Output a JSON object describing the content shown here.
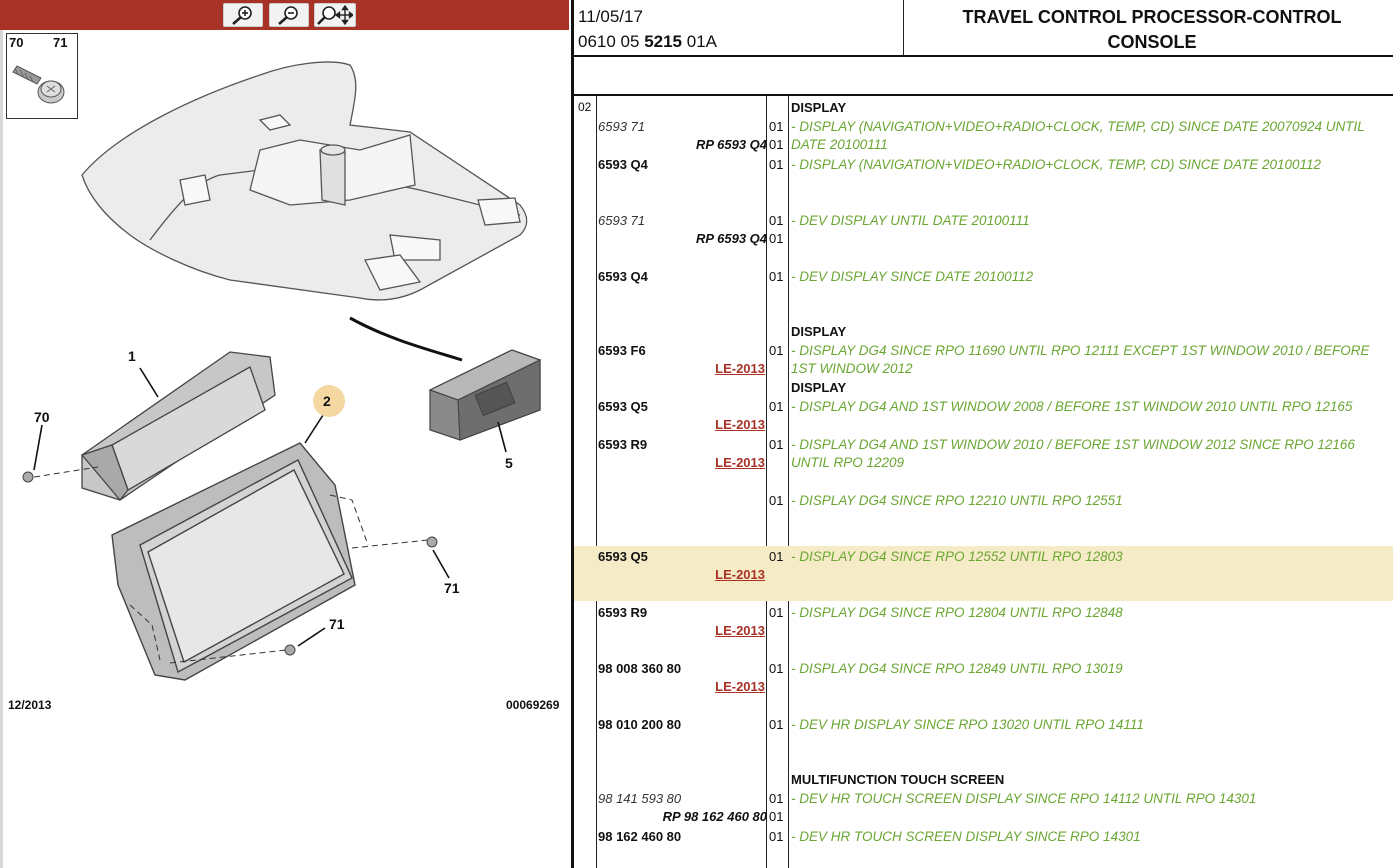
{
  "toolbar": {
    "zoom_in": "zoom-in-icon",
    "zoom_out": "zoom-out-icon",
    "zoom_pan": "zoom-pan-icon",
    "bar_color": "#a93226"
  },
  "diagram": {
    "screw_box_labels": [
      "70",
      "71"
    ],
    "callouts": [
      "1",
      "2",
      "70",
      "5",
      "71",
      "71"
    ],
    "date": "12/2013",
    "ref": "00069269"
  },
  "header": {
    "date": "11/05/17",
    "code_prefix": "0610 05 ",
    "code_bold": "5215",
    "code_suffix": " 01A",
    "title_line1": "TRAVEL CONTROL PROCESSOR-CONTROL",
    "title_line2": "CONSOLE"
  },
  "table": {
    "group": "02",
    "rows": [
      {
        "heading": "DISPLAY"
      },
      {
        "part": "6593 71",
        "replaced_by": "RP 6593 Q4",
        "qty": "01",
        "qty2": "01",
        "desc": "- DISPLAY (NAVIGATION+VIDEO+RADIO+CLOCK, TEMP, CD) SINCE DATE 20070924 UNTIL DATE 20100111"
      },
      {
        "part": "6593 Q4",
        "qty": "01",
        "desc": "- DISPLAY (NAVIGATION+VIDEO+RADIO+CLOCK, TEMP, CD) SINCE DATE 20100112"
      },
      {
        "part": "6593 71",
        "replaced_by": "RP 6593 Q4",
        "qty": "01",
        "qty2": "01",
        "desc": "- DEV DISPLAY UNTIL DATE 20100111"
      },
      {
        "part": "6593 Q4",
        "qty": "01",
        "desc": "- DEV DISPLAY SINCE DATE 20100112"
      },
      {
        "heading": "DISPLAY"
      },
      {
        "part": "6593 F6",
        "link": "LE-2013",
        "qty": "01",
        "desc": "- DISPLAY DG4 SINCE RPO 11690 UNTIL RPO 12111 EXCEPT 1ST WINDOW 2010 / BEFORE 1ST WINDOW 2012"
      },
      {
        "heading": "DISPLAY"
      },
      {
        "part": "6593 Q5",
        "link": "LE-2013",
        "qty": "01",
        "desc": "- DISPLAY DG4 AND 1ST WINDOW 2008 / BEFORE 1ST WINDOW 2010 UNTIL RPO 12165"
      },
      {
        "part": "6593 R9",
        "link": "LE-2013",
        "qty": "01",
        "desc": "- DISPLAY DG4 AND 1ST WINDOW 2010 / BEFORE 1ST WINDOW 2012 SINCE RPO 12166 UNTIL RPO 12209"
      },
      {
        "part": "",
        "qty": "01",
        "desc": "- DISPLAY DG4 SINCE RPO 12210 UNTIL RPO 12551"
      },
      {
        "part": "6593 Q5",
        "link": "LE-2013",
        "qty": "01",
        "desc": "- DISPLAY DG4 SINCE RPO 12552 UNTIL RPO 12803",
        "highlight": true
      },
      {
        "part": "6593 R9",
        "link": "LE-2013",
        "qty": "01",
        "desc": "- DISPLAY DG4 SINCE RPO 12804 UNTIL RPO 12848"
      },
      {
        "part": "98 008 360 80",
        "link": "LE-2013",
        "qty": "01",
        "desc": "- DISPLAY DG4 SINCE RPO 12849 UNTIL RPO 13019"
      },
      {
        "part": "98 010 200 80",
        "qty": "01",
        "desc": "- DEV HR DISPLAY SINCE RPO 13020 UNTIL RPO 14111"
      },
      {
        "heading": "MULTIFUNCTION TOUCH SCREEN"
      },
      {
        "part": "98 141 593 80",
        "replaced_by": "RP 98 162 460 80",
        "qty": "01",
        "qty2": "01",
        "desc": "- DEV HR TOUCH SCREEN DISPLAY SINCE RPO 14112 UNTIL RPO 14301"
      },
      {
        "part": "98 162 460 80",
        "qty": "01",
        "desc": "- DEV HR TOUCH SCREEN DISPLAY SINCE RPO 14301"
      }
    ],
    "colors": {
      "desc": "#6aa632",
      "link": "#a93226",
      "highlight": "#f6ebc7"
    }
  }
}
